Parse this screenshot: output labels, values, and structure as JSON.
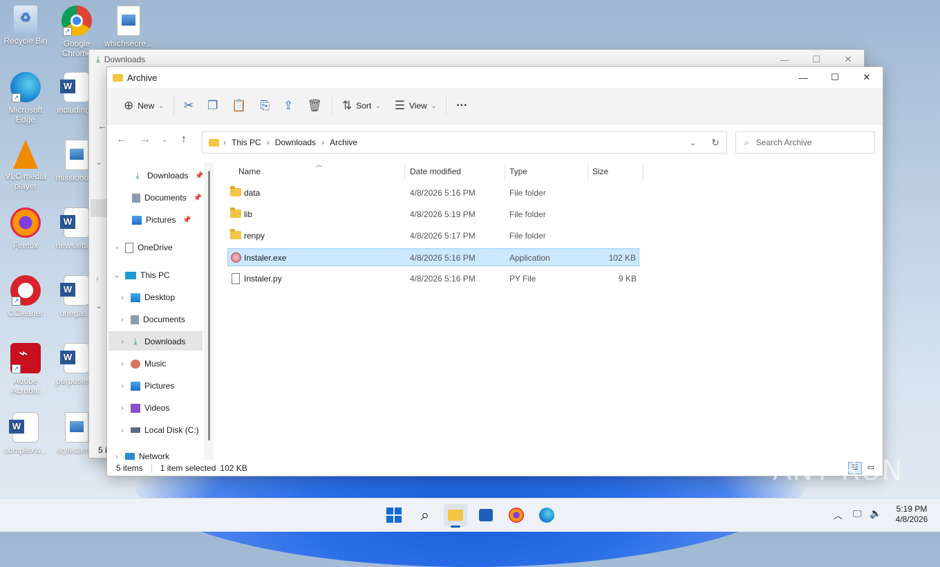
{
  "desktop": {
    "icons": [
      {
        "label": "Recycle Bin"
      },
      {
        "label": "Google Chrome"
      },
      {
        "label": "whichsecre..."
      },
      {
        "label": "Microsoft Edge"
      },
      {
        "label": "including..."
      },
      {
        "label": "VLC media player"
      },
      {
        "label": "missionor..."
      },
      {
        "label": "Firefox"
      },
      {
        "label": "newslette..."
      },
      {
        "label": "CCleaner"
      },
      {
        "label": "onegas..."
      },
      {
        "label": "Adobe Acrobat"
      },
      {
        "label": "purposen..."
      },
      {
        "label": "complexw..."
      },
      {
        "label": "stylecam..."
      }
    ]
  },
  "back_window": {
    "title": "Downloads",
    "status_fragment": "5 i"
  },
  "window": {
    "title": "Archive",
    "toolbar": {
      "new_label": "New",
      "sort_label": "Sort",
      "view_label": "View",
      "more": "···"
    },
    "address": {
      "crumbs": [
        "This PC",
        "Downloads",
        "Archive"
      ]
    },
    "search": {
      "placeholder": "Search Archive"
    },
    "nav": {
      "quick": [
        {
          "label": "Downloads"
        },
        {
          "label": "Documents"
        },
        {
          "label": "Pictures"
        }
      ],
      "onedrive": "OneDrive",
      "thispc": "This PC",
      "pc_items": [
        {
          "label": "Desktop"
        },
        {
          "label": "Documents"
        },
        {
          "label": "Downloads"
        },
        {
          "label": "Music"
        },
        {
          "label": "Pictures"
        },
        {
          "label": "Videos"
        },
        {
          "label": "Local Disk (C:)"
        }
      ],
      "network": "Network"
    },
    "columns": {
      "name": "Name",
      "date": "Date modified",
      "type": "Type",
      "size": "Size"
    },
    "files": [
      {
        "name": "data",
        "date": "4/8/2026 5:16 PM",
        "type": "File folder",
        "size": ""
      },
      {
        "name": "lib",
        "date": "4/8/2026 5:19 PM",
        "type": "File folder",
        "size": ""
      },
      {
        "name": "renpy",
        "date": "4/8/2026 5:17 PM",
        "type": "File folder",
        "size": ""
      },
      {
        "name": "Instaler.exe",
        "date": "4/8/2026 5:16 PM",
        "type": "Application",
        "size": "102 KB"
      },
      {
        "name": "Instaler.py",
        "date": "4/8/2026 5:16 PM",
        "type": "PY File",
        "size": "9 KB"
      }
    ],
    "status": {
      "items": "5 items",
      "selected": "1 item selected",
      "selected_size": "102 KB"
    }
  },
  "taskbar": {
    "time": "5:19 PM",
    "date": "4/8/2026"
  },
  "watermark": "ANY RUN",
  "colors": {
    "accent": "#0067c0",
    "selection": "#cce8ff",
    "folder": "#f4c542"
  }
}
